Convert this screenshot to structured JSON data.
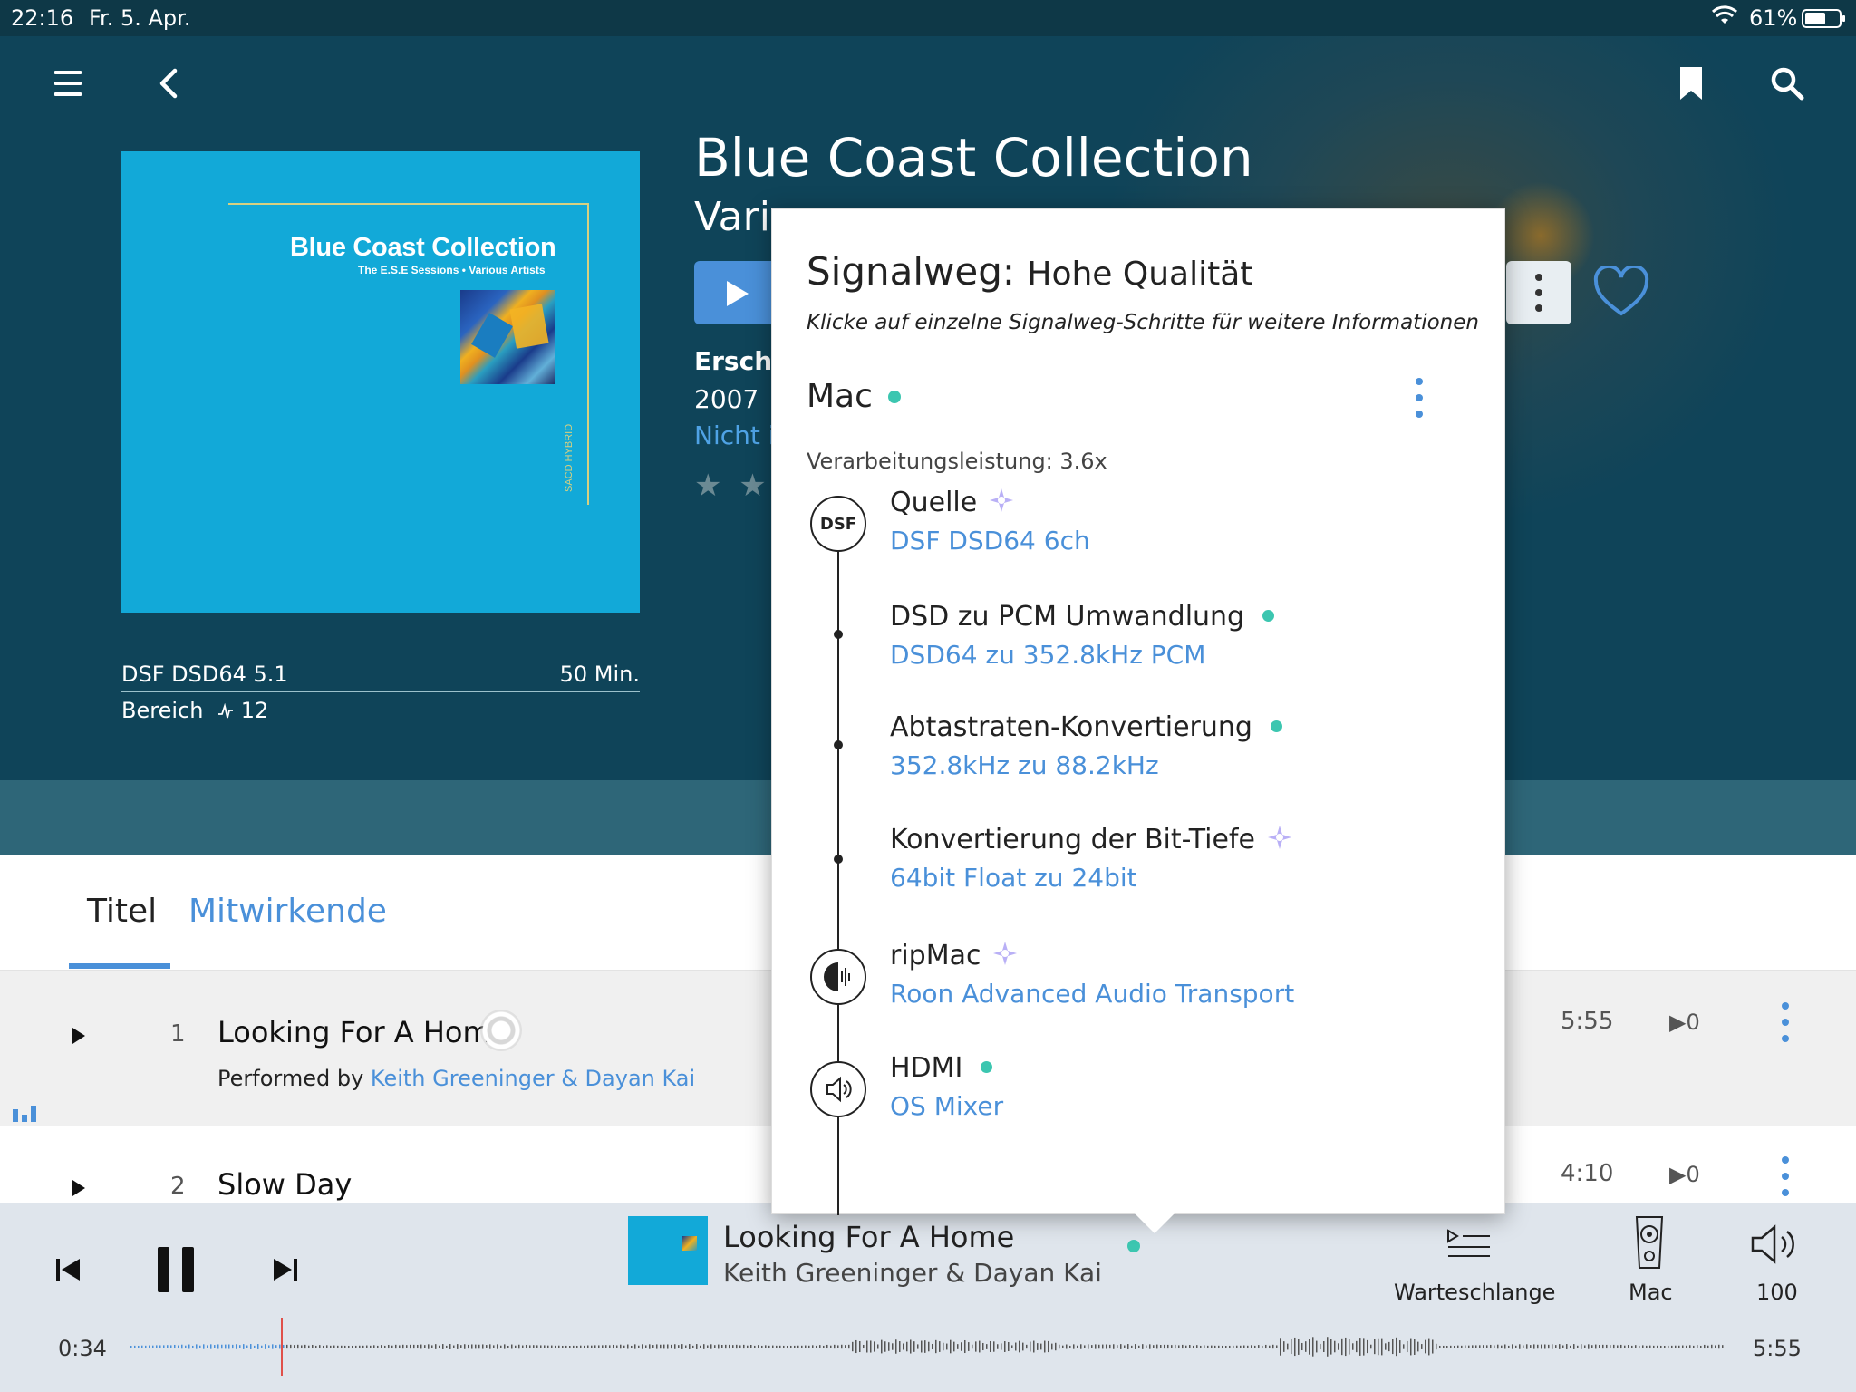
{
  "status_bar": {
    "time": "22:16",
    "date": "Fr. 5. Apr.",
    "battery": "61%",
    "battery_level": 0.61
  },
  "header": {
    "menu_icon": "hamburger-menu-icon",
    "back_icon": "chevron-left-icon",
    "bookmark_icon": "bookmark-icon",
    "search_icon": "search-icon"
  },
  "album": {
    "title": "Blue Coast Collection",
    "artist": "Various Artists",
    "artist_visible": "Vari",
    "cover_title": "Blue Coast Collection",
    "cover_subtitle": "The E.S.E Sessions • Various Artists",
    "cover_tag": "SACD HYBRID",
    "format": "DSF DSD64 5.1",
    "duration": "50 Min.",
    "range_label": "Bereich",
    "range_value": "12",
    "released_label": "Erschie",
    "released_year": "2007",
    "library_status": "Nicht i",
    "rating_visible": "★ ★",
    "colors": {
      "accent": "#4a90d9",
      "hero_bg": "#0f4459",
      "cover": "#12a9d8",
      "quality_green": "#3cc6b0",
      "enhanced_purple": "#8a7cf0"
    }
  },
  "tabs": [
    {
      "label": "Titel",
      "active": true
    },
    {
      "label": "Mitwirkende",
      "active": false
    }
  ],
  "tracks": [
    {
      "number": "1",
      "title": "Looking For A Home",
      "performed_by_label": "Performed by",
      "performers": "Keith Greeninger & Dayan Kai",
      "duration": "5:55",
      "plays": "0",
      "playing": true
    },
    {
      "number": "2",
      "title": "Slow Day",
      "duration": "4:10",
      "plays": "0",
      "playing": false
    }
  ],
  "signal_path": {
    "title": "Signalweg:",
    "quality": "Hohe Qualität",
    "hint": "Klicke auf einzelne Signalweg-Schritte für weitere Informationen",
    "zone": "Mac",
    "processing": "Verarbeitungsleistung: 3.6x",
    "steps": [
      {
        "name": "Quelle",
        "value": "DSF DSD64 6ch",
        "badge": "DSF",
        "quality": "enhanced"
      },
      {
        "name": "DSD zu PCM Umwandlung",
        "value": "DSD64 zu 352.8kHz PCM",
        "quality": "high"
      },
      {
        "name": "Abtastraten-Konvertierung",
        "value": "352.8kHz zu 88.2kHz",
        "quality": "high"
      },
      {
        "name": "Konvertierung der Bit-Tiefe",
        "value": "64bit Float zu 24bit",
        "quality": "enhanced"
      },
      {
        "name": "ripMac",
        "value": "Roon Advanced Audio Transport",
        "icon": "roon-transport-icon",
        "quality": "enhanced"
      },
      {
        "name": "HDMI",
        "value": "OS Mixer",
        "icon": "speaker-icon",
        "quality": "high"
      }
    ]
  },
  "now_playing": {
    "title": "Looking For A Home",
    "artist": "Keith Greeninger & Dayan Kai",
    "queue_label": "Warteschlange",
    "zone_label": "Mac",
    "volume_label": "100",
    "elapsed": "0:34",
    "total": "5:55",
    "progress": 0.096
  }
}
